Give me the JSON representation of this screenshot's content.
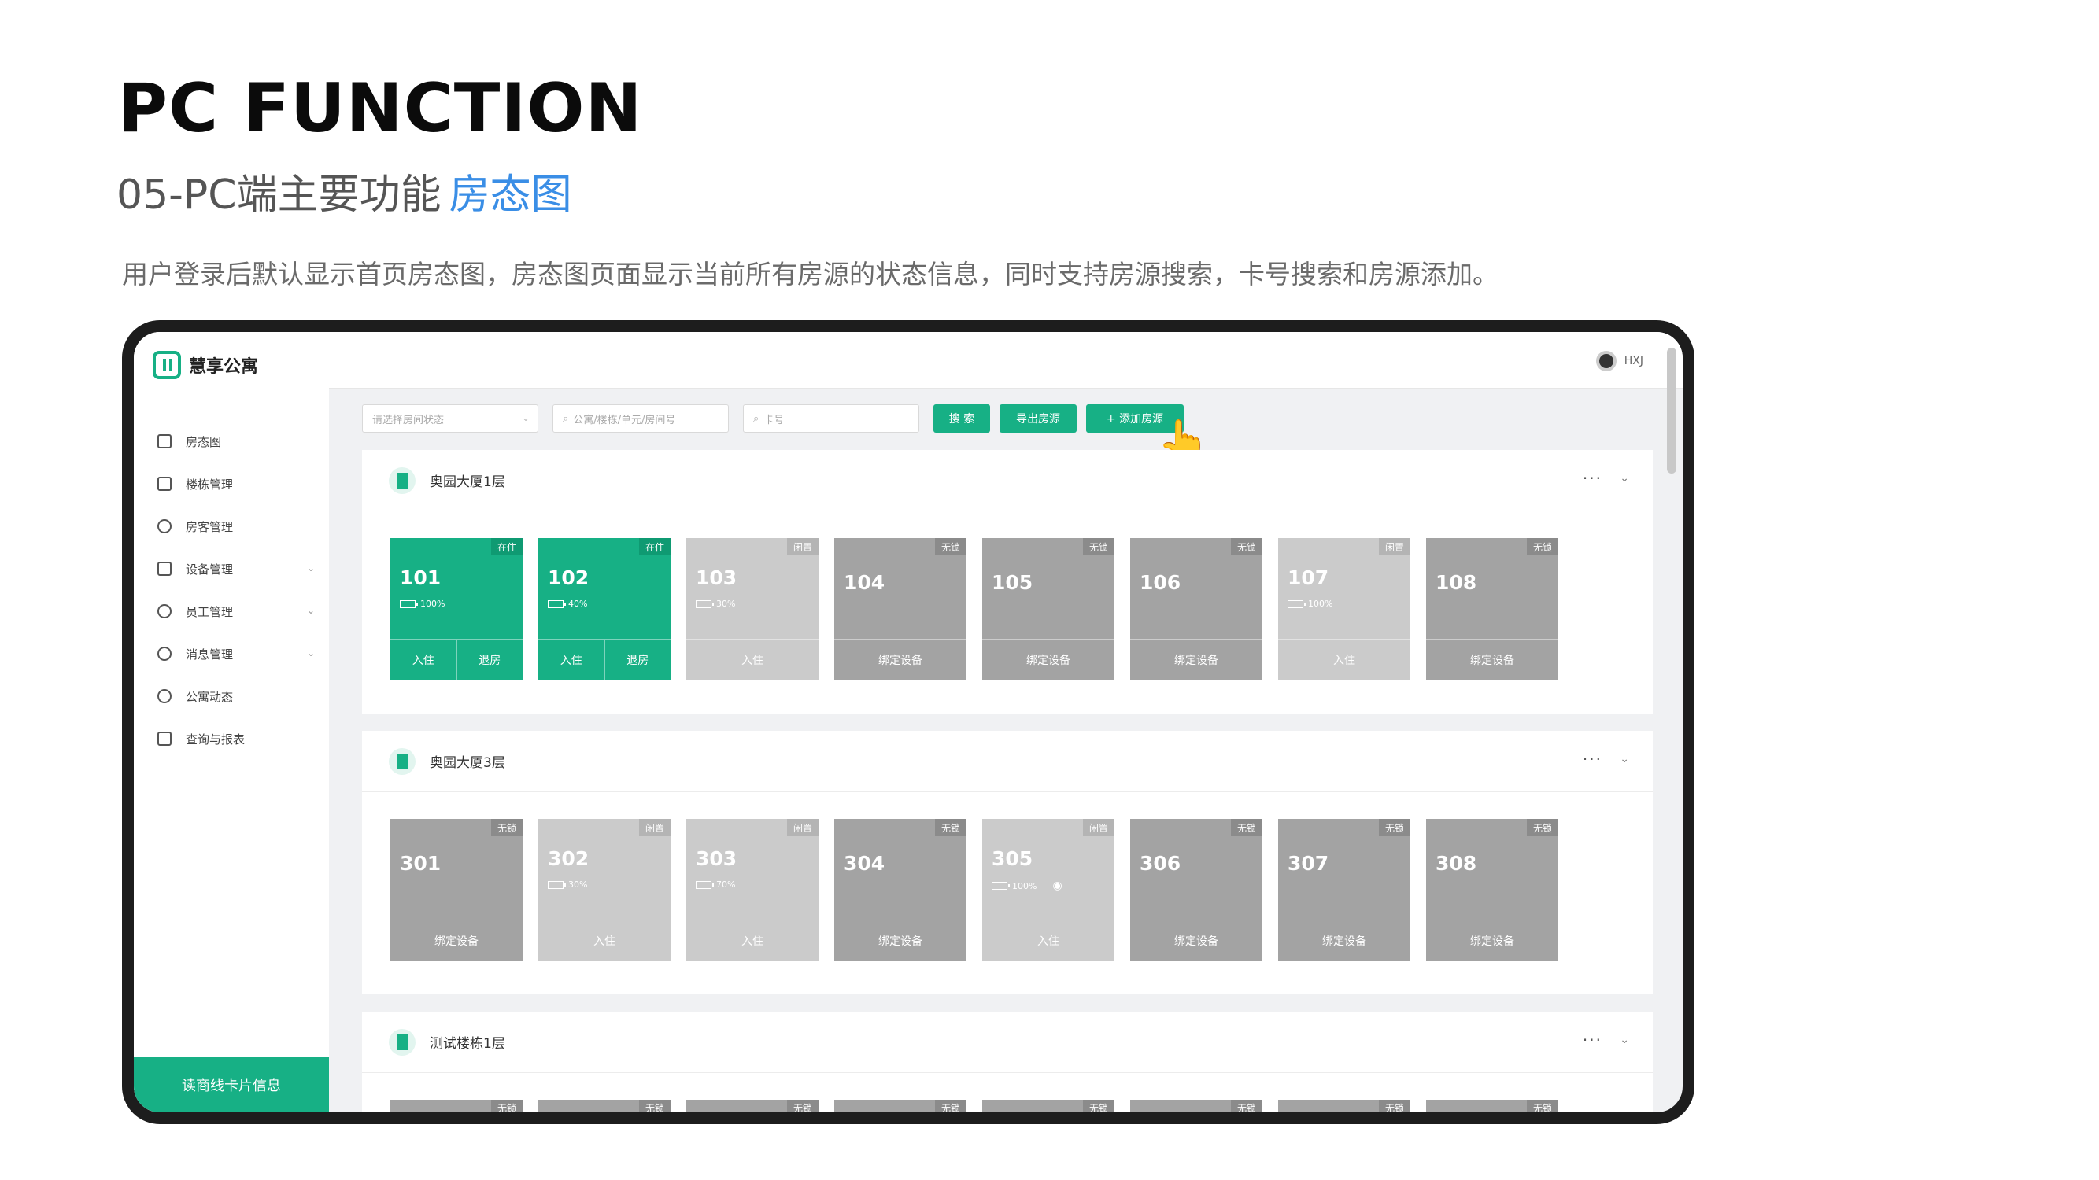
{
  "header": {
    "title": "PC FUNCTION",
    "subtitle": "05-PC端主要功能",
    "subtitle_accent": "房态图",
    "description": "用户登录后默认显示首页房态图，房态图页面显示当前所有房源的状态信息，同时支持房源搜索，卡号搜索和房源添加。"
  },
  "app": {
    "brand": "慧享公寓",
    "user": "HXJ",
    "sidebar": [
      {
        "label": "房态图",
        "icon": "home-icon"
      },
      {
        "label": "楼栋管理",
        "icon": "building-icon"
      },
      {
        "label": "房客管理",
        "icon": "tenant-icon"
      },
      {
        "label": "设备管理",
        "icon": "device-icon"
      },
      {
        "label": "员工管理",
        "icon": "staff-icon"
      },
      {
        "label": "消息管理",
        "icon": "bell-icon"
      },
      {
        "label": "公寓动态",
        "icon": "compass-icon"
      },
      {
        "label": "查询与报表",
        "icon": "report-icon"
      }
    ],
    "footer": "读商线卡片信息",
    "toolbar": {
      "status_placeholder": "请选择房间状态",
      "search_placeholder": "公寓/楼栋/单元/房间号",
      "card_placeholder": "卡号",
      "search_btn": "搜 索",
      "export_btn": "导出房源",
      "add_btn": "+ 添加房源"
    },
    "floors": [
      {
        "title": "奥园大厦1层",
        "rooms": [
          {
            "num": "101",
            "status": "在住",
            "battery": "100%",
            "actions": [
              "入住",
              "退房"
            ]
          },
          {
            "num": "102",
            "status": "在住",
            "battery": "40%",
            "actions": [
              "入住",
              "退房"
            ]
          },
          {
            "num": "103",
            "status": "闲置",
            "battery": "30%",
            "actions": [
              "入住"
            ]
          },
          {
            "num": "104",
            "status": "无锁",
            "battery": "",
            "actions": [
              "绑定设备"
            ]
          },
          {
            "num": "105",
            "status": "无锁",
            "battery": "",
            "actions": [
              "绑定设备"
            ]
          },
          {
            "num": "106",
            "status": "无锁",
            "battery": "",
            "actions": [
              "绑定设备"
            ]
          },
          {
            "num": "107",
            "status": "闲置",
            "battery": "100%",
            "actions": [
              "入住"
            ]
          },
          {
            "num": "108",
            "status": "无锁",
            "battery": "",
            "actions": [
              "绑定设备"
            ]
          }
        ]
      },
      {
        "title": "奥园大厦3层",
        "rooms": [
          {
            "num": "301",
            "status": "无锁",
            "battery": "",
            "actions": [
              "绑定设备"
            ]
          },
          {
            "num": "302",
            "status": "闲置",
            "battery": "30%",
            "actions": [
              "入住"
            ]
          },
          {
            "num": "303",
            "status": "闲置",
            "battery": "70%",
            "actions": [
              "入住"
            ]
          },
          {
            "num": "304",
            "status": "无锁",
            "battery": "",
            "actions": [
              "绑定设备"
            ]
          },
          {
            "num": "305",
            "status": "闲置",
            "battery": "100%",
            "actions": [
              "入住"
            ]
          },
          {
            "num": "306",
            "status": "无锁",
            "battery": "",
            "actions": [
              "绑定设备"
            ]
          },
          {
            "num": "307",
            "status": "无锁",
            "battery": "",
            "actions": [
              "绑定设备"
            ]
          },
          {
            "num": "308",
            "status": "无锁",
            "battery": "",
            "actions": [
              "绑定设备"
            ]
          }
        ]
      },
      {
        "title": "测试楼栋1层",
        "rooms": [
          {
            "status": "无锁"
          },
          {
            "status": "无锁"
          },
          {
            "status": "无锁"
          },
          {
            "status": "无锁"
          },
          {
            "status": "无锁"
          },
          {
            "status": "无锁"
          },
          {
            "status": "无锁"
          },
          {
            "status": "无锁"
          }
        ]
      }
    ]
  }
}
